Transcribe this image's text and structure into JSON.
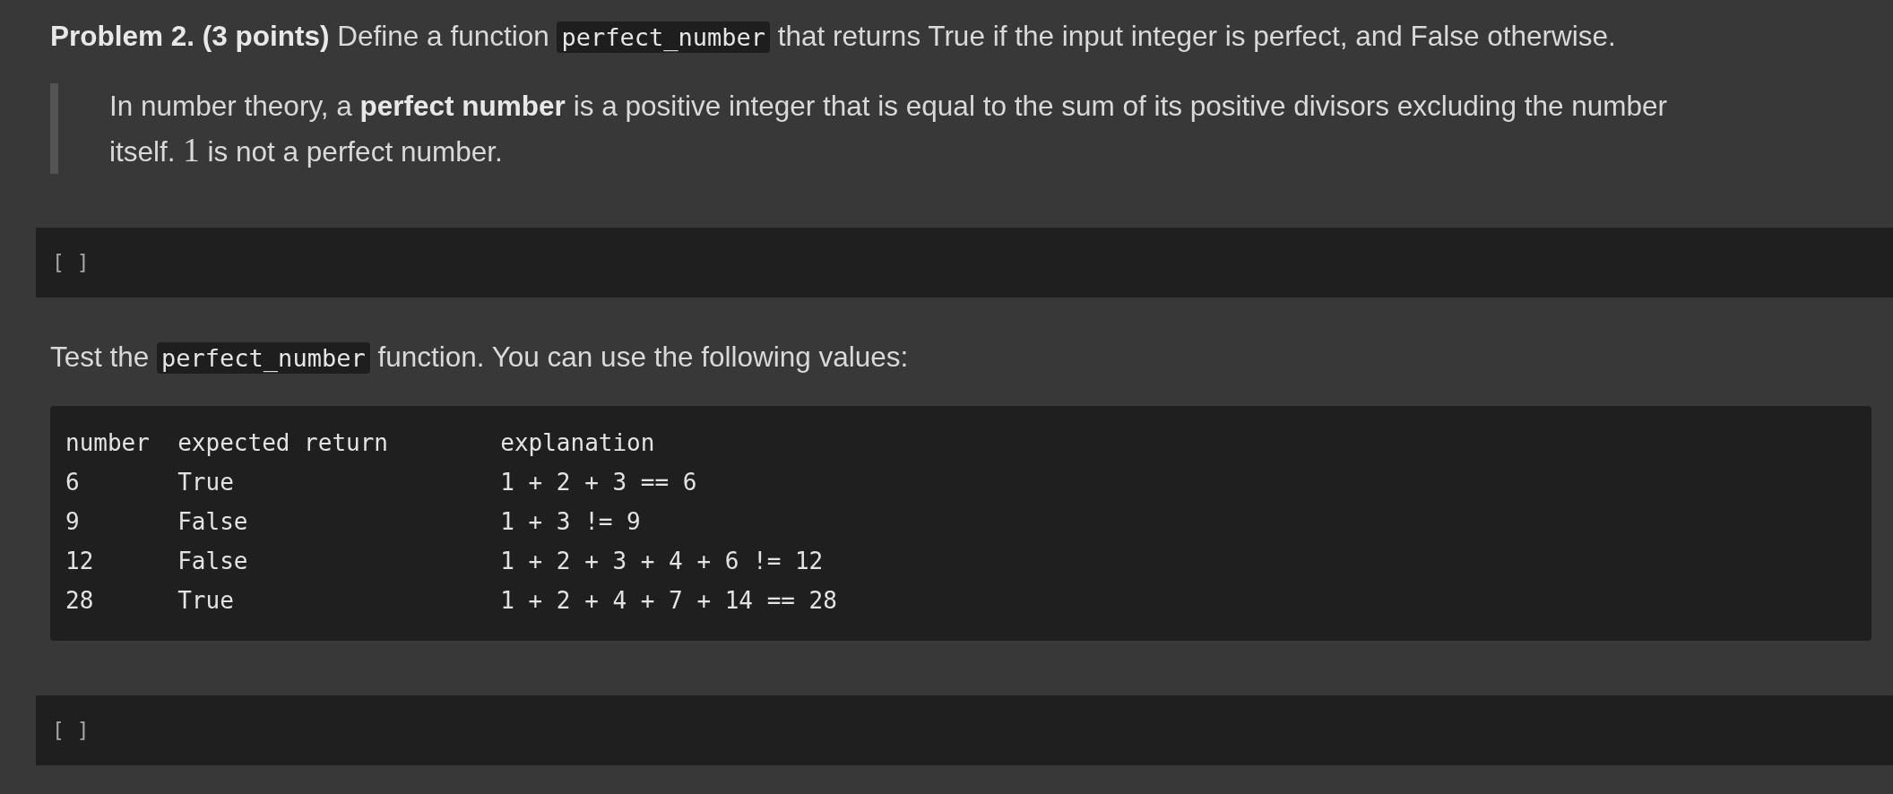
{
  "blocks": [
    {
      "kind": "paragraph",
      "segments": [
        {
          "kind": "bold",
          "text": "Problem 2. (3 points)"
        },
        {
          "kind": "text",
          "text": " Define a function "
        },
        {
          "kind": "code",
          "text": "perfect_number"
        },
        {
          "kind": "text",
          "text": " that returns True if the input integer is perfect, and False otherwise."
        }
      ]
    },
    {
      "kind": "quote",
      "segments": [
        {
          "kind": "text",
          "text": "In number theory, a "
        },
        {
          "kind": "bold",
          "text": "perfect number"
        },
        {
          "kind": "text",
          "text": " is a positive integer that is equal to the sum of its positive divisors excluding the number itself. "
        },
        {
          "kind": "math",
          "text": "1"
        },
        {
          "kind": "text",
          "text": " is not a perfect number."
        }
      ]
    },
    {
      "kind": "code_cell",
      "prompt": "[ ]"
    },
    {
      "kind": "paragraph",
      "segments": [
        {
          "kind": "text",
          "text": "Test the "
        },
        {
          "kind": "code",
          "text": "perfect_number"
        },
        {
          "kind": "text",
          "text": " function. You can use the following values:"
        }
      ]
    },
    {
      "kind": "values_table",
      "columns": [
        "number",
        "expected return",
        "explanation"
      ],
      "rows": [
        [
          "6",
          "True",
          "1 + 2 + 3 == 6"
        ],
        [
          "9",
          "False",
          "1 + 3 != 9"
        ],
        [
          "12",
          "False",
          "1 + 2 + 3 + 4 + 6 != 12"
        ],
        [
          "28",
          "True",
          "1 + 2 + 4 + 7 + 14 == 28"
        ]
      ]
    },
    {
      "kind": "code_cell",
      "prompt": "[ ]"
    }
  ]
}
